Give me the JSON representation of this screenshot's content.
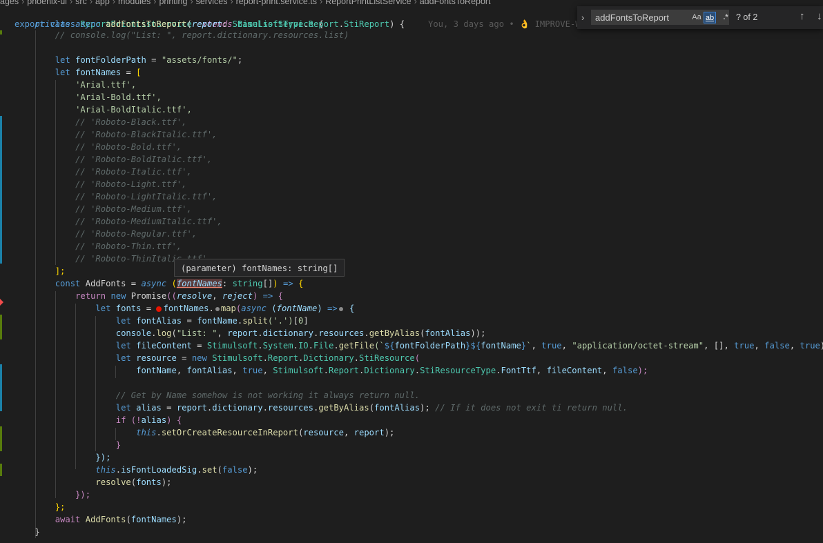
{
  "breadcrumb": {
    "items": [
      "ages",
      "phoenix-ui",
      "src",
      "app",
      "modules",
      "printing",
      "services",
      "report-print.service.ts",
      "ReportPrintListService",
      "addFontsToReport"
    ],
    "separator": "›"
  },
  "find": {
    "query": "addFontsToReport",
    "match_case_label": "Aa",
    "whole_word_label": "ab",
    "regex_label": ".*",
    "count": "? of 2",
    "prev_icon": "↑",
    "next_icon": "↓",
    "toggle_icon": "›"
  },
  "hover": {
    "text": "(parameter) fontNames: string[]"
  },
  "blame": {
    "text": "You, 3 days ago • 👌 IMPROVE-W"
  },
  "code": {
    "l01": [
      "export",
      "class",
      "ReportPrintListService",
      "extends",
      "BaseListService",
      "{"
    ],
    "l02": [
      "private",
      "async",
      "addFontsToReport",
      "(",
      "report",
      ":",
      "StimulsoftType",
      ".",
      "Report",
      ".",
      "StiReport",
      ")",
      "{"
    ],
    "l03": "// console.log(\"List: \", report.dictionary.resources.list)",
    "l04": [
      "let",
      "fontFolderPath",
      "=",
      "\"assets/fonts/\"",
      ";"
    ],
    "l05": [
      "let",
      "fontNames",
      "=",
      "["
    ],
    "fonts_active": [
      "'Arial.ttf',",
      "'Arial-Bold.ttf',",
      "'Arial-BoldItalic.ttf',"
    ],
    "fonts_commented": [
      "// 'Roboto-Black.ttf',",
      "// 'Roboto-BlackItalic.ttf',",
      "// 'Roboto-Bold.ttf',",
      "// 'Roboto-BoldItalic.ttf',",
      "// 'Roboto-Italic.ttf',",
      "// 'Roboto-Light.ttf',",
      "// 'Roboto-LightItalic.ttf',",
      "// 'Roboto-Medium.ttf',",
      "// 'Roboto-MediumItalic.ttf',",
      "// 'Roboto-Regular.ttf',",
      "// 'Roboto-Thin.ttf',",
      "// 'Roboto-ThinItalic.ttf',"
    ],
    "l_close_arr": "];",
    "l_addfonts": [
      "const",
      "AddFonts",
      "=",
      "async",
      "(",
      "fontNames",
      ":",
      "string",
      "[]",
      ")",
      "=>",
      "{"
    ],
    "l_return": [
      "return",
      "new",
      "Promise",
      "((",
      "resolve",
      ",",
      "reject",
      ")",
      "=>",
      "{"
    ],
    "l_letfonts": [
      "let",
      "fonts",
      "=",
      "fontNames",
      ".",
      "map",
      "(",
      "async",
      "(",
      "fontName",
      ")",
      "=>",
      "{"
    ],
    "l_alias": [
      "let",
      "fontAlias",
      "=",
      "fontName",
      ".",
      "split",
      "('",
      ".",
      "')",
      "[",
      "0",
      "]"
    ],
    "l_console": [
      "console",
      ".",
      "log",
      "(",
      "\"List: \"",
      ", ",
      "report",
      ".",
      "dictionary",
      ".",
      "resources",
      ".",
      "getByAlias",
      "(",
      "fontAlias",
      "));"
    ],
    "l_file": [
      "let",
      "fileContent",
      "=",
      "Stimulsoft",
      ".",
      "System",
      ".",
      "IO",
      ".",
      "File",
      ".",
      "getFile",
      "(`",
      "${",
      "fontFolderPath",
      "}${",
      "fontName",
      "}",
      "`",
      ", ",
      "true",
      ", ",
      "\"application/octet-stream\"",
      ", [], ",
      "true",
      ", ",
      "false",
      ", ",
      "true",
      ");"
    ],
    "l_res": [
      "let",
      "resource",
      "=",
      "new",
      "Stimulsoft",
      ".",
      "Report",
      ".",
      "Dictionary",
      ".",
      "StiResource",
      "("
    ],
    "l_res_args": [
      "fontName",
      ", ",
      "fontAlias",
      ", ",
      "true",
      ", ",
      "Stimulsoft",
      ".",
      "Report",
      ".",
      "Dictionary",
      ".",
      "StiResourceType",
      ".",
      "FontTtf",
      ", ",
      "fileContent",
      ", ",
      "false",
      ");"
    ],
    "l_cmt2": "// Get by Name somehow is not working it always return null.",
    "l_let_alias": [
      "let",
      "alias",
      "=",
      "report",
      ".",
      "dictionary",
      ".",
      "resources",
      ".",
      "getByAlias",
      "(",
      "fontAlias",
      ");",
      "// If it does not exit ti return null."
    ],
    "l_if": [
      "if",
      "(!",
      "alias",
      ") {"
    ],
    "l_this_set": [
      "this",
      ".",
      "setOrCreateResourceInReport",
      "(",
      "resource",
      ", ",
      "report",
      ");"
    ],
    "l_close1": "}",
    "l_close2": "});",
    "l_loaded": [
      "this",
      ".",
      "isFontLoadedSig",
      ".",
      "set",
      "(",
      "false",
      ");"
    ],
    "l_resolve": [
      "resolve",
      "(",
      "fonts",
      ");"
    ],
    "l_close3": "});",
    "l_close4": "};",
    "l_await": [
      "await",
      "AddFonts",
      "(",
      "fontNames",
      ");"
    ],
    "l_close5": "}"
  }
}
